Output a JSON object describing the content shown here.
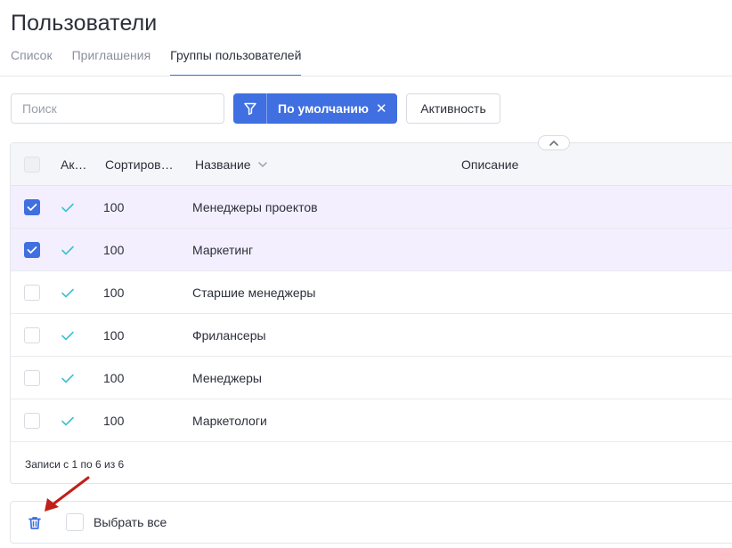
{
  "page": {
    "title": "Пользователи"
  },
  "tabs": [
    {
      "label": "Список",
      "active": false
    },
    {
      "label": "Приглашения",
      "active": false
    },
    {
      "label": "Группы пользователей",
      "active": true
    }
  ],
  "toolbar": {
    "search_placeholder": "Поиск",
    "filter_label": "По умолчанию",
    "filter_clear": "✕",
    "activity_label": "Активность"
  },
  "table": {
    "columns": {
      "active": "Ак…",
      "sort": "Сортиров…",
      "name": "Название",
      "description": "Описание"
    },
    "rows": [
      {
        "checked": true,
        "active": "✓",
        "sort": "100",
        "name": "Менеджеры проектов",
        "description": ""
      },
      {
        "checked": true,
        "active": "✓",
        "sort": "100",
        "name": "Маркетинг",
        "description": ""
      },
      {
        "checked": false,
        "active": "✓",
        "sort": "100",
        "name": "Старшие менеджеры",
        "description": ""
      },
      {
        "checked": false,
        "active": "✓",
        "sort": "100",
        "name": "Фрилансеры",
        "description": ""
      },
      {
        "checked": false,
        "active": "✓",
        "sort": "100",
        "name": "Менеджеры",
        "description": ""
      },
      {
        "checked": false,
        "active": "✓",
        "sort": "100",
        "name": "Маркетологи",
        "description": ""
      }
    ],
    "records_info": "Записи с 1 по 6 из 6"
  },
  "bulk": {
    "select_all_label": "Выбрать все",
    "delete_icon": "trash-icon"
  },
  "colors": {
    "accent": "#3f6fe0",
    "selected_row": "#f3efff",
    "check_mark": "#3cc2cf",
    "annotation_arrow": "#c0201a"
  }
}
